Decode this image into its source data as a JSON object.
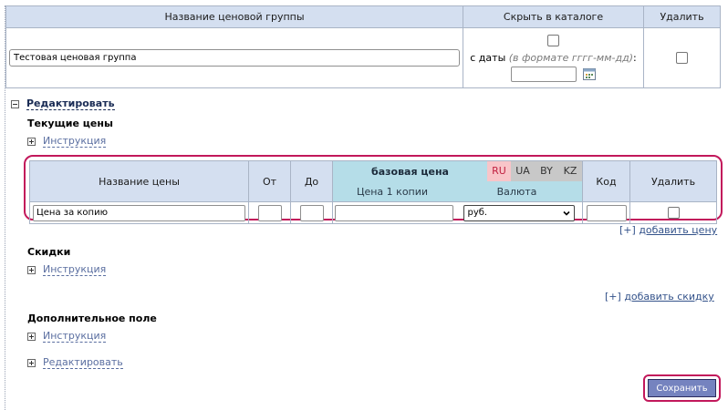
{
  "group_table": {
    "col_name": "Название ценовой группы",
    "col_hide": "Скрыть в каталоге",
    "col_delete": "Удалить",
    "group_name_value": "Тестовая ценовая группа",
    "from_date_label": "с даты",
    "date_format_hint": "(в формате гггг-мм-дд)",
    "date_suffix": ":"
  },
  "edit_toggle": {
    "label": "Редактировать"
  },
  "current_prices": {
    "title": "Текущие цены",
    "instruction": "Инструкция",
    "headers": {
      "price_name": "Название цены",
      "from": "От",
      "to": "До",
      "base_price": "базовая цена",
      "price_per_copy": "Цена 1 копии",
      "currency": "Валюта",
      "code": "Код",
      "delete": "Удалить"
    },
    "currency_tabs": [
      "RU",
      "UA",
      "BY",
      "KZ"
    ],
    "row": {
      "price_name_value": "Цена за копию",
      "currency_selected": "руб."
    },
    "add_price_bracket": "[+]",
    "add_price_label": "добавить цену"
  },
  "discounts": {
    "title": "Скидки",
    "instruction": "Инструкция",
    "add_bracket": "[+]",
    "add_label": "добавить скидку"
  },
  "extra_field": {
    "title": "Дополнительное поле",
    "instruction": "Инструкция",
    "edit": "Редактировать"
  },
  "save_button": "Сохранить",
  "colors": {
    "header_bg": "#d4dff0",
    "base_price_bg": "#b5dde8",
    "highlight_border": "#c2185b",
    "save_bg": "#7583bf",
    "ru_tab": "#f8c5c9"
  }
}
